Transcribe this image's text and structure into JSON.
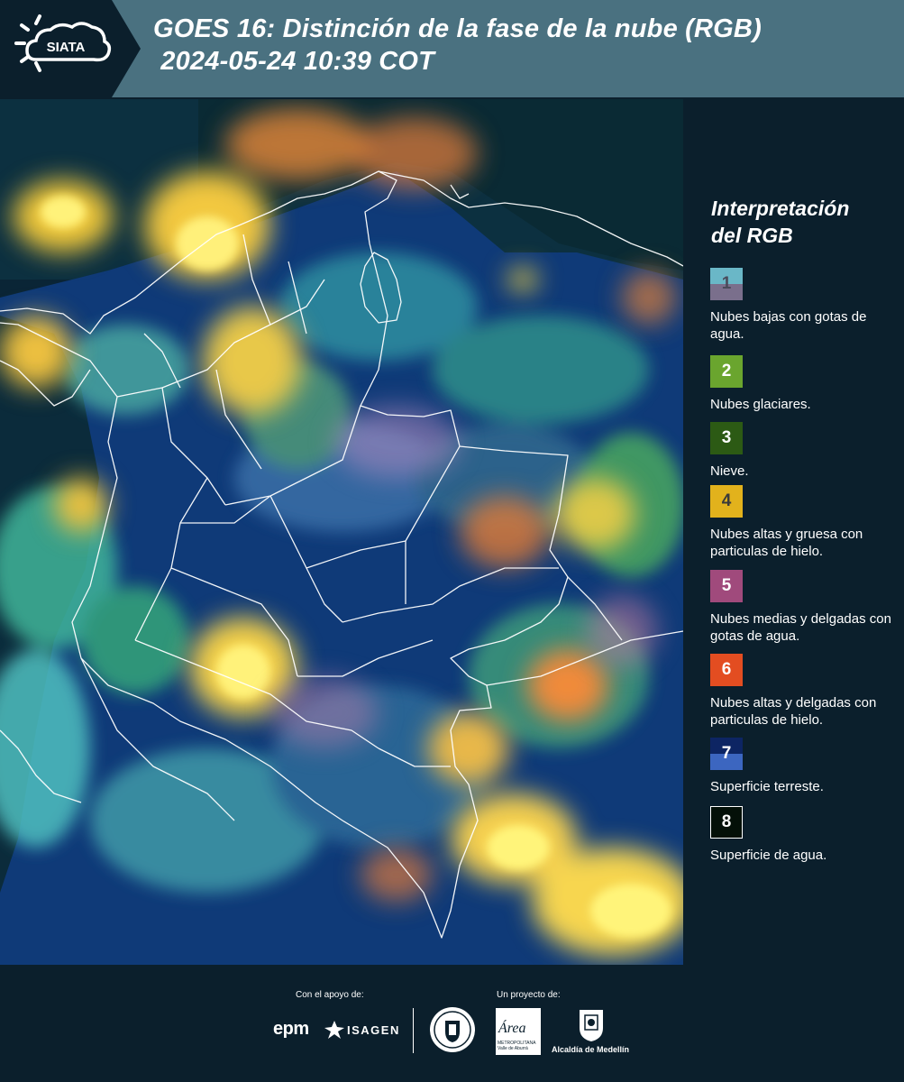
{
  "header": {
    "logo_text": "SIATA",
    "title_line1": "GOES 16: Distinción de la fase de la nube (RGB)",
    "title_line2": " 2024-05-24 10:39 COT"
  },
  "legend": {
    "title_line1": "Interpretación",
    "title_line2": "del RGB",
    "items": [
      {
        "num": "1",
        "label": "Nubes bajas con gotas de agua.",
        "color_top": "#6ab7c7",
        "color_bottom": "#7a6f8c"
      },
      {
        "num": "2",
        "label": "Nubes glaciares.",
        "color": "#6aa52e"
      },
      {
        "num": "3",
        "label": "Nieve.",
        "color": "#2c5a14"
      },
      {
        "num": "4",
        "label": "Nubes altas y gruesa con particulas de hielo.",
        "color": "#e2b21c"
      },
      {
        "num": "5",
        "label": "Nubes medias y delgadas con gotas de agua.",
        "color": "#a04a7c"
      },
      {
        "num": "6",
        "label": "Nubes altas y delgadas con particulas de hielo.",
        "color": "#e34d21"
      },
      {
        "num": "7",
        "label": "Superficie terreste.",
        "color_top": "#0d2563",
        "color_bottom": "#3c66c0"
      },
      {
        "num": "8",
        "label": "Superficie de agua.",
        "color": "#041008"
      }
    ]
  },
  "footer": {
    "support_label": "Con el apoyo de:",
    "project_label": "Un proyecto de:",
    "sponsor1": "epm",
    "sponsor2": "ISAGEN",
    "partner1": "Área",
    "partner1_sub": "METROPOLITANA Valle de Aburrá",
    "partner2": "Alcaldía de Medellín"
  }
}
